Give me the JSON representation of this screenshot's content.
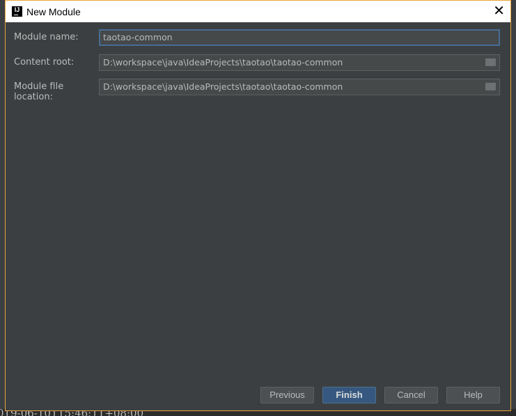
{
  "dialog": {
    "title": "New Module",
    "logo_text": "IJ",
    "fields": [
      {
        "label": "Module name:",
        "value": "taotao-common"
      },
      {
        "label": "Content root:",
        "value": "D:\\workspace\\java\\IdeaProjects\\taotao\\taotao-common"
      },
      {
        "label": "Module file location:",
        "value": "D:\\workspace\\java\\IdeaProjects\\taotao\\taotao-common"
      }
    ],
    "buttons": {
      "previous": "Previous",
      "finish": "Finish",
      "cancel": "Cancel",
      "help": "Help"
    }
  },
  "background": {
    "log_text": "019-06-10T15:46:11+08:00"
  },
  "colors": {
    "accent": "#365880",
    "border": "#e8a33a",
    "panel": "#3c3f41"
  }
}
